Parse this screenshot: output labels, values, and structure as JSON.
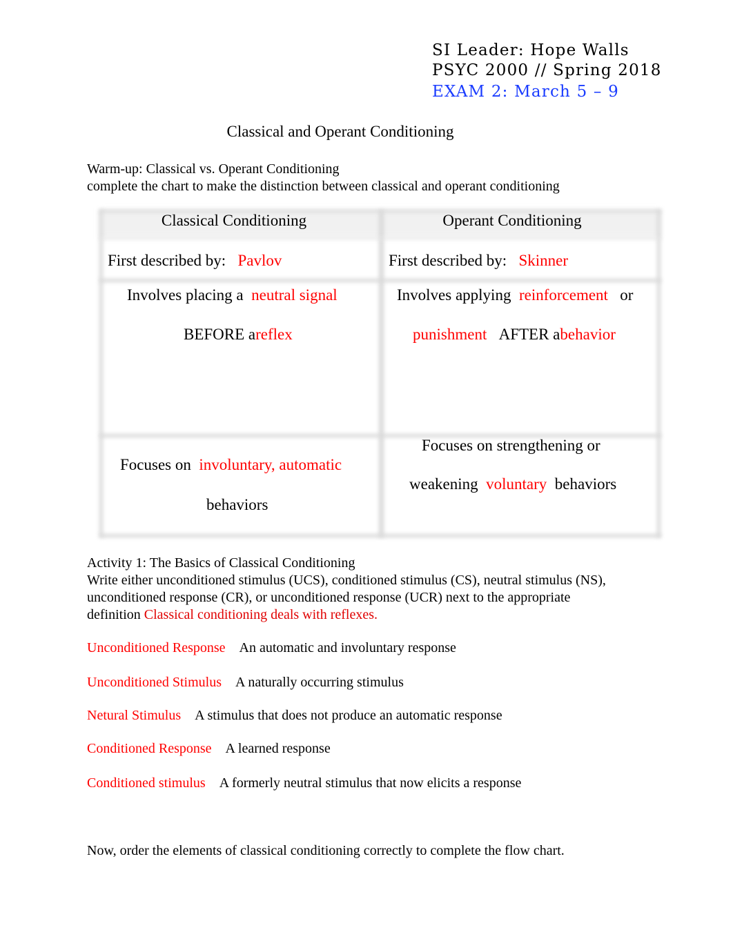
{
  "header": {
    "si_leader": "SI Leader: Hope Walls",
    "course": "PSYC 2000 // Spring 2018",
    "exam": "EXAM 2: March 5 – 9"
  },
  "title": "Classical and Operant Conditioning",
  "warmup": {
    "heading": "Warm-up: Classical vs. Operant Conditioning",
    "instructions": "complete the chart to make the distinction between classical and operant conditioning",
    "table": {
      "columns": [
        "Classical Conditioning",
        "Operant Conditioning"
      ],
      "classical": {
        "described_label": "First described by:",
        "described_answer": "Pavlov",
        "involves_prefix": "Involves placing a",
        "involves_answer": "neutral signal",
        "before_prefix": "BEFORE a",
        "before_answer": "reflex",
        "focus_prefix": "Focuses on",
        "focus_answer": "involuntary, automatic",
        "focus_suffix": "behaviors"
      },
      "operant": {
        "described_label": "First described by:",
        "described_answer": "Skinner",
        "involves_prefix": "Involves applying",
        "involves_answer_1": "reinforcement",
        "involves_or": "or",
        "involves_answer_2": "punishment",
        "after_prefix": "AFTER a",
        "after_answer": "behavior",
        "focus_line1": "Focuses on strengthening or",
        "focus_prefix": "weakening",
        "focus_answer": "voluntary",
        "focus_suffix": "behaviors"
      }
    }
  },
  "activity1": {
    "heading": "Activity 1: The Basics of Classical Conditioning",
    "instructions_line1": "Write either unconditioned stimulus (UCS), conditioned stimulus (CS), neutral stimulus (NS),",
    "instructions_line2": "unconditioned response (CR), or unconditioned response (UCR) next to the appropriate",
    "instructions_line3": "definition",
    "note": "Classical conditioning deals with reflexes.",
    "items": [
      {
        "answer": "Unconditioned Response",
        "definition": "An automatic and involuntary response"
      },
      {
        "answer": "Unconditioned Stimulus",
        "definition": "A naturally occurring stimulus"
      },
      {
        "answer": "Netural Stimulus",
        "definition": "A stimulus that does not produce an automatic response"
      },
      {
        "answer": "Conditioned Response",
        "definition": "A learned response"
      },
      {
        "answer": "Conditioned stimulus",
        "definition": "A formerly neutral stimulus that now elicits a response"
      }
    ]
  },
  "flowchart_prompt": "Now, order the elements of classical conditioning correctly to complete the flow chart.",
  "colors": {
    "answer_red": "#ff0000",
    "note_red": "#e00000",
    "exam_blue": "#1a3cff"
  }
}
